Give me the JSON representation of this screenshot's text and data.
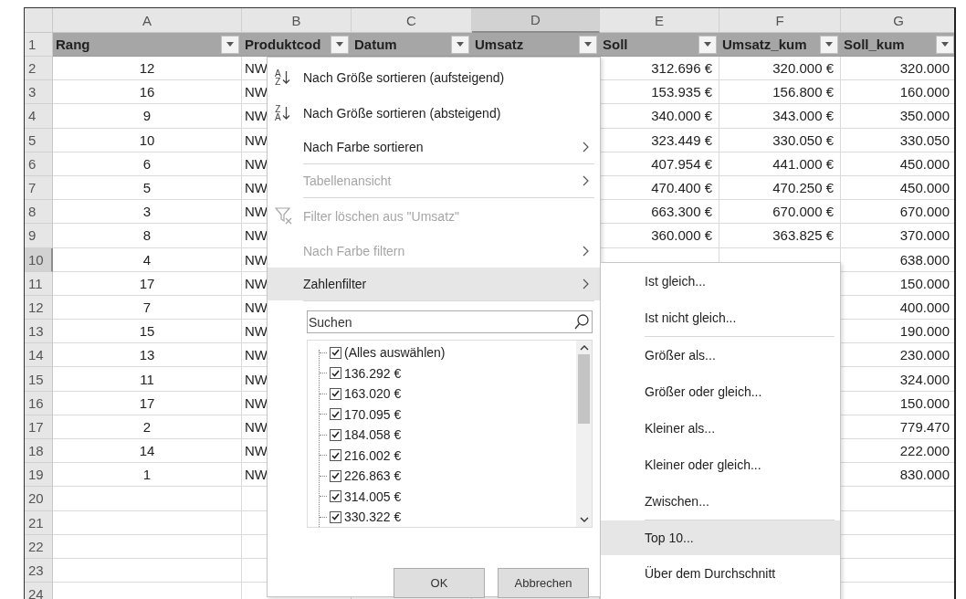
{
  "columns": [
    {
      "letter": "A",
      "selected": false
    },
    {
      "letter": "B",
      "selected": false
    },
    {
      "letter": "C",
      "selected": false
    },
    {
      "letter": "D",
      "selected": true
    },
    {
      "letter": "E",
      "selected": false
    },
    {
      "letter": "F",
      "selected": false
    },
    {
      "letter": "G",
      "selected": false
    }
  ],
  "header_row": {
    "number": "1",
    "labels": [
      "Rang",
      "Produktcod",
      "Datum",
      "Umsatz",
      "Soll",
      "Umsatz_kum",
      "Soll_kum"
    ]
  },
  "rows": [
    {
      "number": "2",
      "selected": false,
      "values": {
        "A": "12",
        "B": "NW",
        "E": "312.696 €",
        "F": "320.000 €",
        "G": "320.000"
      }
    },
    {
      "number": "3",
      "selected": false,
      "values": {
        "A": "16",
        "B": "NW",
        "E": "153.935 €",
        "F": "156.800 €",
        "G": "160.000"
      }
    },
    {
      "number": "4",
      "selected": false,
      "values": {
        "A": "9",
        "B": "NW",
        "E": "340.000 €",
        "F": "343.000 €",
        "G": "350.000"
      }
    },
    {
      "number": "5",
      "selected": false,
      "values": {
        "A": "10",
        "B": "NW",
        "E": "323.449 €",
        "F": "330.050 €",
        "G": "330.050"
      }
    },
    {
      "number": "6",
      "selected": false,
      "values": {
        "A": "6",
        "B": "NW",
        "E": "407.954 €",
        "F": "441.000 €",
        "G": "450.000"
      }
    },
    {
      "number": "7",
      "selected": false,
      "values": {
        "A": "5",
        "B": "NW",
        "E": "470.400 €",
        "F": "470.250 €",
        "G": "450.000"
      }
    },
    {
      "number": "8",
      "selected": false,
      "values": {
        "A": "3",
        "B": "NW",
        "E": "663.300 €",
        "F": "670.000 €",
        "G": "670.000"
      }
    },
    {
      "number": "9",
      "selected": false,
      "values": {
        "A": "8",
        "B": "NW",
        "E": "360.000 €",
        "F": "363.825 €",
        "G": "370.000"
      }
    },
    {
      "number": "10",
      "selected": true,
      "values": {
        "A": "4",
        "B": "NW",
        "G": "638.000"
      }
    },
    {
      "number": "11",
      "selected": false,
      "values": {
        "A": "17",
        "B": "NW",
        "G": "150.000"
      }
    },
    {
      "number": "12",
      "selected": false,
      "values": {
        "A": "7",
        "B": "NW",
        "G": "400.000"
      }
    },
    {
      "number": "13",
      "selected": false,
      "values": {
        "A": "15",
        "B": "NW",
        "G": "190.000"
      }
    },
    {
      "number": "14",
      "selected": false,
      "values": {
        "A": "13",
        "B": "NW",
        "G": "230.000"
      }
    },
    {
      "number": "15",
      "selected": false,
      "values": {
        "A": "11",
        "B": "NW",
        "G": "324.000"
      }
    },
    {
      "number": "16",
      "selected": false,
      "values": {
        "A": "17",
        "B": "NW",
        "G": "150.000"
      }
    },
    {
      "number": "17",
      "selected": false,
      "values": {
        "A": "2",
        "B": "NW",
        "G": "779.470"
      }
    },
    {
      "number": "18",
      "selected": false,
      "values": {
        "A": "14",
        "B": "NW",
        "G": "222.000"
      }
    },
    {
      "number": "19",
      "selected": false,
      "values": {
        "A": "1",
        "B": "NW",
        "G": "830.000"
      }
    },
    {
      "number": "20",
      "selected": false,
      "values": {}
    },
    {
      "number": "21",
      "selected": false,
      "values": {}
    },
    {
      "number": "22",
      "selected": false,
      "values": {}
    },
    {
      "number": "23",
      "selected": false,
      "values": {}
    },
    {
      "number": "24",
      "selected": false,
      "values": {}
    }
  ],
  "filter_menu": {
    "items": [
      {
        "kind": "sort",
        "icon": [
          "A",
          "Z"
        ],
        "label": "Nach Größe sortieren (aufsteigend)",
        "disabled": false,
        "selected": false
      },
      {
        "kind": "sort",
        "icon": [
          "Z",
          "A"
        ],
        "label": "Nach Größe sortieren (absteigend)",
        "disabled": false,
        "selected": false
      },
      {
        "kind": "submenu",
        "label": "Nach Farbe sortieren",
        "disabled": false,
        "selected": false
      },
      {
        "kind": "separator"
      },
      {
        "kind": "submenu",
        "label": "Tabellenansicht",
        "disabled": true,
        "selected": false
      },
      {
        "kind": "separator"
      },
      {
        "kind": "clear",
        "label": "Filter löschen aus \"Umsatz\"",
        "disabled": true,
        "selected": false
      },
      {
        "kind": "submenu",
        "label": "Nach Farbe filtern",
        "disabled": true,
        "selected": false
      },
      {
        "kind": "submenu",
        "label": "Zahlenfilter",
        "disabled": false,
        "selected": true
      },
      {
        "kind": "separator"
      }
    ],
    "search": {
      "placeholder": "Suchen"
    },
    "values": [
      {
        "label": "(Alles auswählen)",
        "checked": true
      },
      {
        "label": "136.292 €",
        "checked": true
      },
      {
        "label": "163.020 €",
        "checked": true
      },
      {
        "label": "170.095 €",
        "checked": true
      },
      {
        "label": "184.058 €",
        "checked": true
      },
      {
        "label": "216.002 €",
        "checked": true
      },
      {
        "label": "226.863 €",
        "checked": true
      },
      {
        "label": "314.005 €",
        "checked": true
      },
      {
        "label": "330.322 €",
        "checked": true
      }
    ],
    "buttons": [
      "OK",
      "Abbrechen"
    ]
  },
  "number_filter_submenu": {
    "items": [
      {
        "kind": "item",
        "label": "Ist gleich...",
        "selected": false
      },
      {
        "kind": "item",
        "label": "Ist nicht gleich...",
        "selected": false
      },
      {
        "kind": "separator"
      },
      {
        "kind": "item",
        "label": "Größer als...",
        "selected": false
      },
      {
        "kind": "item",
        "label": "Größer oder gleich...",
        "selected": false
      },
      {
        "kind": "item",
        "label": "Kleiner als...",
        "selected": false
      },
      {
        "kind": "item",
        "label": "Kleiner oder gleich...",
        "selected": false
      },
      {
        "kind": "item",
        "label": "Zwischen...",
        "selected": false
      },
      {
        "kind": "separator"
      },
      {
        "kind": "item",
        "label": "Top 10...",
        "selected": true
      },
      {
        "kind": "item",
        "label": "Über dem Durchschnitt",
        "selected": false
      }
    ]
  }
}
